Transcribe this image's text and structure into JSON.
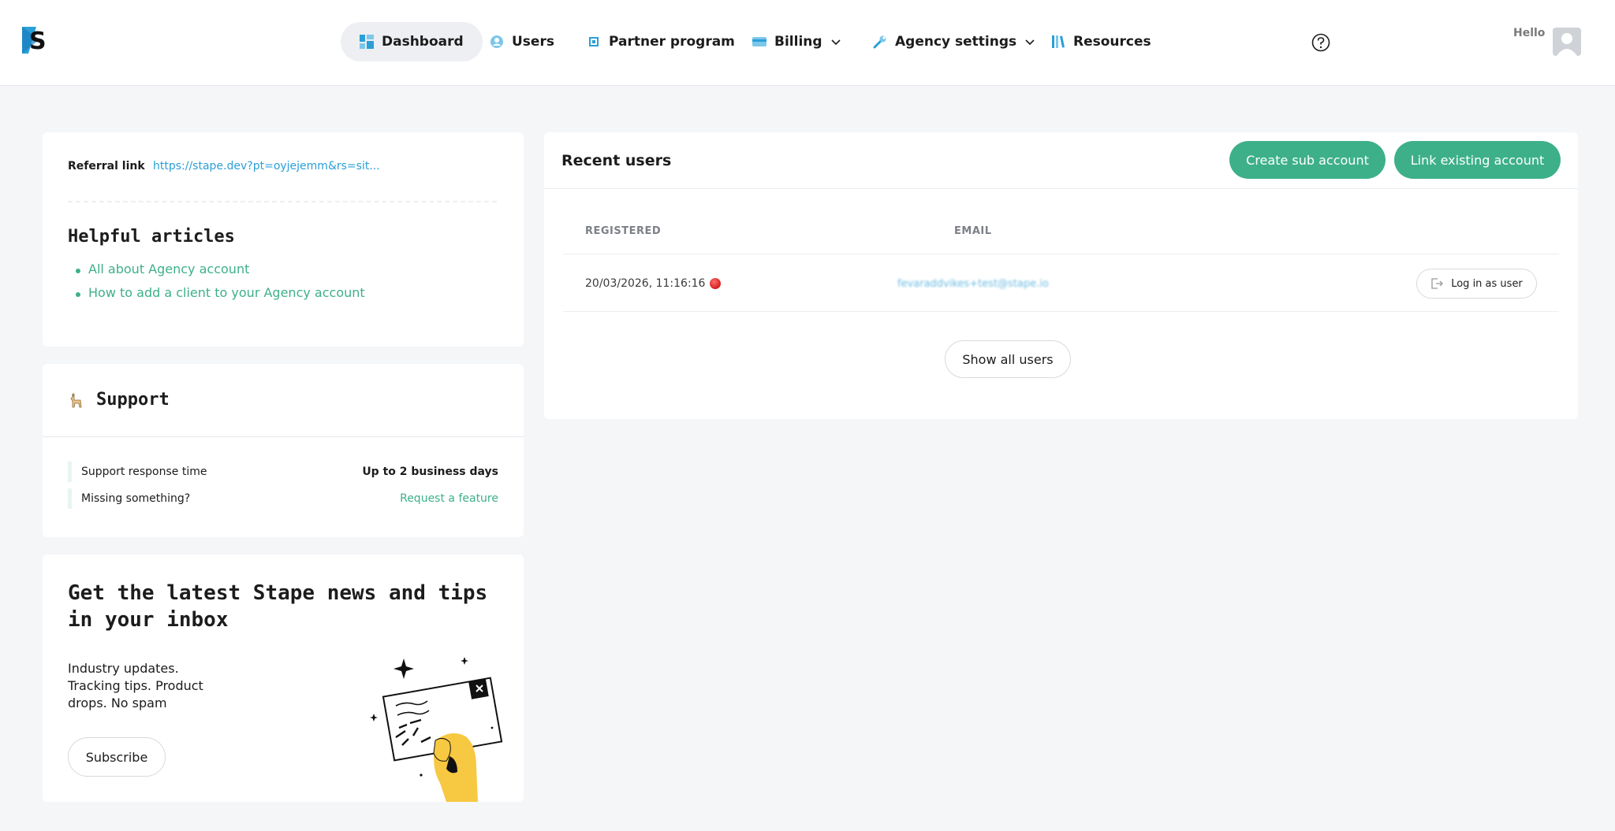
{
  "header": {
    "nav": [
      {
        "label": "Dashboard",
        "icon": "dashboard-icon",
        "active": true
      },
      {
        "label": "Users",
        "icon": "users-icon"
      },
      {
        "label": "Partner program",
        "icon": "partner-icon"
      },
      {
        "label": "Billing",
        "icon": "billing-icon",
        "dropdown": true
      },
      {
        "label": "Agency settings",
        "icon": "wrench-icon",
        "dropdown": true
      },
      {
        "label": "Resources",
        "icon": "resources-icon"
      }
    ],
    "hello": "Hello"
  },
  "referral": {
    "label": "Referral link",
    "link": "https://stape.dev?pt=oyjejemm&rs=sit..."
  },
  "articles": {
    "title": "Helpful articles",
    "items": [
      "All about Agency account",
      "How to add a client to your Agency account"
    ]
  },
  "support": {
    "title": "Support",
    "rows": [
      {
        "label": "Support response time",
        "value": "Up to 2 business days"
      },
      {
        "label": "Missing something?",
        "value": "Request a feature"
      }
    ]
  },
  "news": {
    "title": "Get the latest Stape news and tips in your inbox",
    "text": "Industry updates. Tracking tips. Product drops. No spam",
    "subscribe": "Subscribe"
  },
  "recent_users": {
    "title": "Recent users",
    "create_button": "Create sub account",
    "link_button": "Link existing account",
    "columns": {
      "registered": "REGISTERED",
      "email": "EMAIL"
    },
    "rows": [
      {
        "registered": "20/03/2026, 11:16:16",
        "email": "fevaraddvikes+test@stape.io",
        "action": "Log in as user"
      }
    ],
    "show_all": "Show all users"
  },
  "colors": {
    "accent": "#3db08a",
    "link": "#2a9fd8",
    "background": "#f5f6f8"
  }
}
